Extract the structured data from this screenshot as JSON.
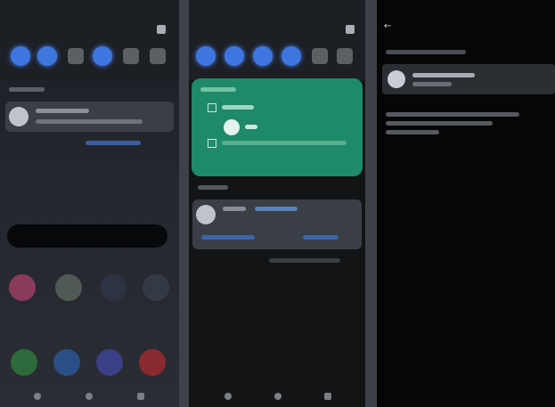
{
  "panel1": {
    "status_left": "",
    "status_right": "",
    "qs_header": "",
    "notification_title": "",
    "notification_body": "",
    "quick_tiles": [
      "on",
      "on",
      "off",
      "on",
      "off",
      "off"
    ]
  },
  "panel2": {
    "status_left": "",
    "status_right": "",
    "qs_header": "",
    "quick_tiles": [
      "on",
      "on",
      "on",
      "on",
      "off",
      "off"
    ],
    "card": {
      "option_a": "",
      "option_b": "",
      "option_c": ""
    },
    "section_label": "",
    "notification_title": "",
    "notification_body": "",
    "action_left": "",
    "action_right": ""
  },
  "panel3": {
    "title": "",
    "item_title": "",
    "item_sub": "",
    "description": ""
  },
  "colors": {
    "accent": "#3e76e0",
    "card_green": "#1f8a6a",
    "link_blue": "#4b86e6"
  }
}
